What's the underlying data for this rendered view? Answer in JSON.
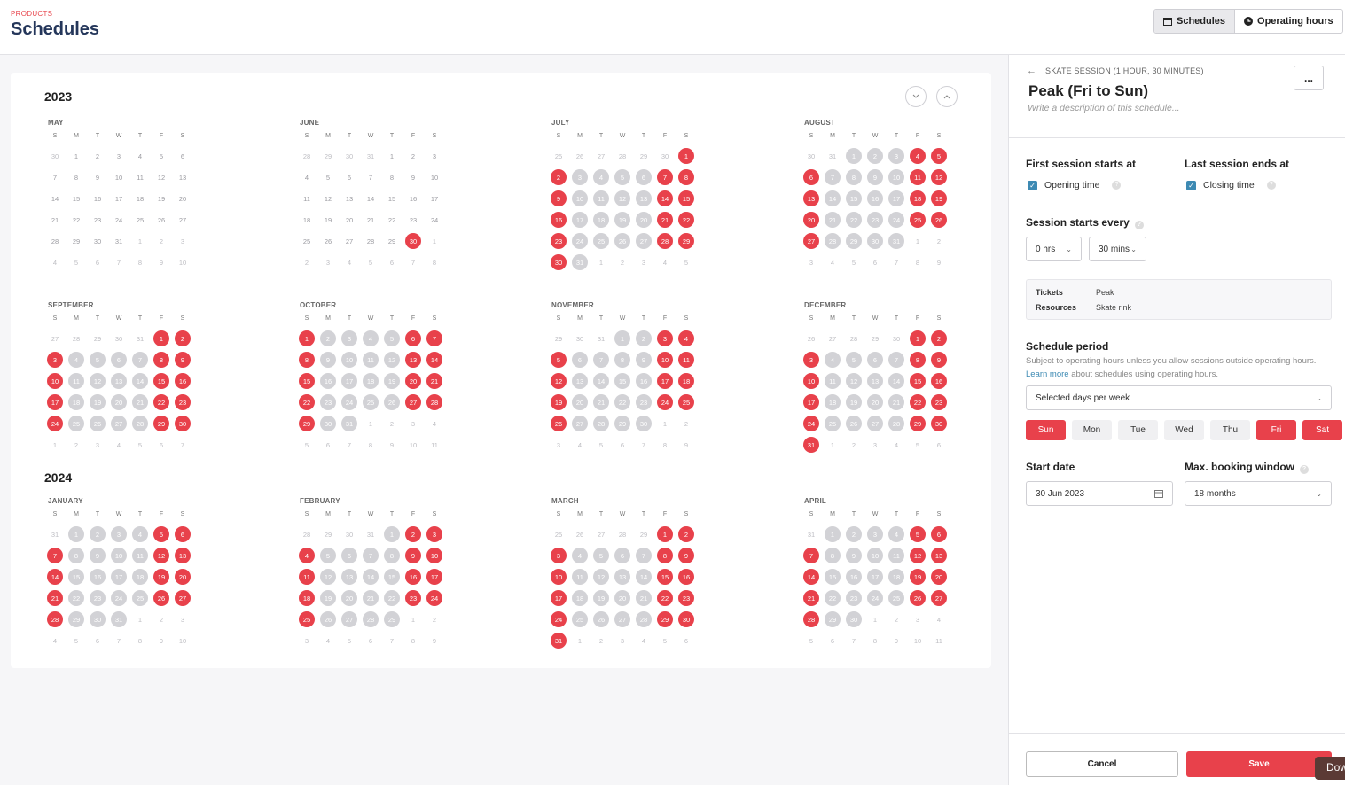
{
  "header": {
    "crumb": "PRODUCTS",
    "title": "Schedules",
    "buttons": [
      "Schedules",
      "Operating hours"
    ]
  },
  "calendar": {
    "dow": [
      "S",
      "M",
      "T",
      "W",
      "T",
      "F",
      "S"
    ],
    "years": [
      {
        "label": "2023",
        "months": [
          {
            "name": "MAY",
            "rows": [
              "30o 1n 2n 3n 4n 5n 6n",
              "7n 8n 9n 10n 11n 12n 13n",
              "14n 15n 16n 17n 18n 19n 20n",
              "21n 22n 23n 24n 25n 26n 27n",
              "28n 29n 30n 31n 1o 2o 3o",
              "4o 5o 6o 7o 8o 9o 10o"
            ]
          },
          {
            "name": "JUNE",
            "rows": [
              "28o 29o 30o 31o 1n 2n 3n",
              "4n 5n 6n 7n 8n 9n 10n",
              "11n 12n 13n 14n 15n 16n 17n",
              "18n 19n 20n 21n 22n 23n 24n",
              "25n 26n 27n 28n 29n 30r 1o",
              "2o 3o 4o 5o 6o 7o 8o"
            ]
          },
          {
            "name": "JULY",
            "rows": [
              "25o 26o 27o 28o 29o 30o 1r",
              "2r 3g 4g 5g 6g 7r 8r",
              "9r 10g 11g 12g 13g 14r 15r",
              "16r 17g 18g 19g 20g 21r 22r",
              "23r 24g 25g 26g 27g 28r 29r",
              "30r 31g 1o 2o 3o 4o 5o"
            ]
          },
          {
            "name": "AUGUST",
            "rows": [
              "30o 31o 1g 2g 3g 4r 5r",
              "6r 7g 8g 9g 10g 11r 12r",
              "13r 14g 15g 16g 17g 18r 19r",
              "20r 21g 22g 23g 24g 25r 26r",
              "27r 28g 29g 30g 31g 1o 2o",
              "3o 4o 5o 6o 7o 8o 9o"
            ]
          },
          {
            "name": "SEPTEMBER",
            "rows": [
              "27o 28o 29o 30o 31o 1r 2r",
              "3r 4g 5g 6g 7g 8r 9r",
              "10r 11g 12g 13g 14g 15r 16r",
              "17r 18g 19g 20g 21g 22r 23r",
              "24r 25g 26g 27g 28g 29r 30r",
              "1o 2o 3o 4o 5o 6o 7o"
            ]
          },
          {
            "name": "OCTOBER",
            "rows": [
              "1r 2g 3g 4g 5g 6r 7r",
              "8r 9g 10g 11g 12g 13r 14r",
              "15r 16g 17g 18g 19g 20r 21r",
              "22r 23g 24g 25g 26g 27r 28r",
              "29r 30g 31g 1o 2o 3o 4o",
              "5o 6o 7o 8o 9o 10o 11o"
            ]
          },
          {
            "name": "NOVEMBER",
            "rows": [
              "29o 30o 31o 1g 2g 3r 4r",
              "5r 6g 7g 8g 9g 10r 11r",
              "12r 13g 14g 15g 16g 17r 18r",
              "19r 20g 21g 22g 23g 24r 25r",
              "26r 27g 28g 29g 30g 1o 2o",
              "3o 4o 5o 6o 7o 8o 9o"
            ]
          },
          {
            "name": "DECEMBER",
            "rows": [
              "26o 27o 28o 29o 30o 1r 2r",
              "3r 4g 5g 6g 7g 8r 9r",
              "10r 11g 12g 13g 14g 15r 16r",
              "17r 18g 19g 20g 21g 22r 23r",
              "24r 25g 26g 27g 28g 29r 30r",
              "31r 1o 2o 3o 4o 5o 6o"
            ]
          }
        ]
      },
      {
        "label": "2024",
        "months": [
          {
            "name": "JANUARY",
            "rows": [
              "31o 1g 2g 3g 4g 5r 6r",
              "7r 8g 9g 10g 11g 12r 13r",
              "14r 15g 16g 17g 18g 19r 20r",
              "21r 22g 23g 24g 25g 26r 27r",
              "28r 29g 30g 31g 1o 2o 3o",
              "4o 5o 6o 7o 8o 9o 10o"
            ]
          },
          {
            "name": "FEBRUARY",
            "rows": [
              "28o 29o 30o 31o 1g 2r 3r",
              "4r 5g 6g 7g 8g 9r 10r",
              "11r 12g 13g 14g 15g 16r 17r",
              "18r 19g 20g 21g 22g 23r 24r",
              "25r 26g 27g 28g 29g 1o 2o",
              "3o 4o 5o 6o 7o 8o 9o"
            ]
          },
          {
            "name": "MARCH",
            "rows": [
              "25o 26o 27o 28o 29o 1r 2r",
              "3r 4g 5g 6g 7g 8r 9r",
              "10r 11g 12g 13g 14g 15r 16r",
              "17r 18g 19g 20g 21g 22r 23r",
              "24r 25g 26g 27g 28g 29r 30r",
              "31r 1o 2o 3o 4o 5o 6o"
            ]
          },
          {
            "name": "APRIL",
            "rows": [
              "31o 1g 2g 3g 4g 5r 6r",
              "7r 8g 9g 10g 11g 12r 13r",
              "14r 15g 16g 17g 18g 19r 20r",
              "21r 22g 23g 24g 25g 26r 27r",
              "28r 29g 30g 1o 2o 3o 4o",
              "5o 6o 7o 8o 9o 10o 11o"
            ]
          }
        ]
      }
    ]
  },
  "panel": {
    "subtitle": "SKATE SESSION (1 HOUR, 30 MINUTES)",
    "title": "Peak (Fri to Sun)",
    "description_placeholder": "Write a description of this schedule...",
    "more": "...",
    "first_session_label": "First session starts at",
    "first_session_option": "Opening time",
    "last_session_label": "Last session ends at",
    "last_session_option": "Closing time",
    "every_label": "Session starts every",
    "hours": "0 hrs",
    "minutes": "30 mins",
    "tickets_key": "Tickets",
    "tickets_val": "Peak",
    "resources_key": "Resources",
    "resources_val": "Skate rink",
    "period_label": "Schedule period",
    "period_note_1": "Subject to operating hours unless you allow sessions outside operating hours.",
    "period_link": "Learn more",
    "period_note_2": "about schedules using operating hours.",
    "period_select": "Selected days per week",
    "days": [
      {
        "label": "Sun",
        "on": true
      },
      {
        "label": "Mon",
        "on": false
      },
      {
        "label": "Tue",
        "on": false
      },
      {
        "label": "Wed",
        "on": false
      },
      {
        "label": "Thu",
        "on": false
      },
      {
        "label": "Fri",
        "on": true
      },
      {
        "label": "Sat",
        "on": true
      }
    ],
    "start_label": "Start date",
    "start_value": "30 Jun 2023",
    "window_label": "Max. booking window",
    "window_value": "18 months",
    "cancel": "Cancel",
    "save": "Save"
  },
  "tooltip": "Dow"
}
